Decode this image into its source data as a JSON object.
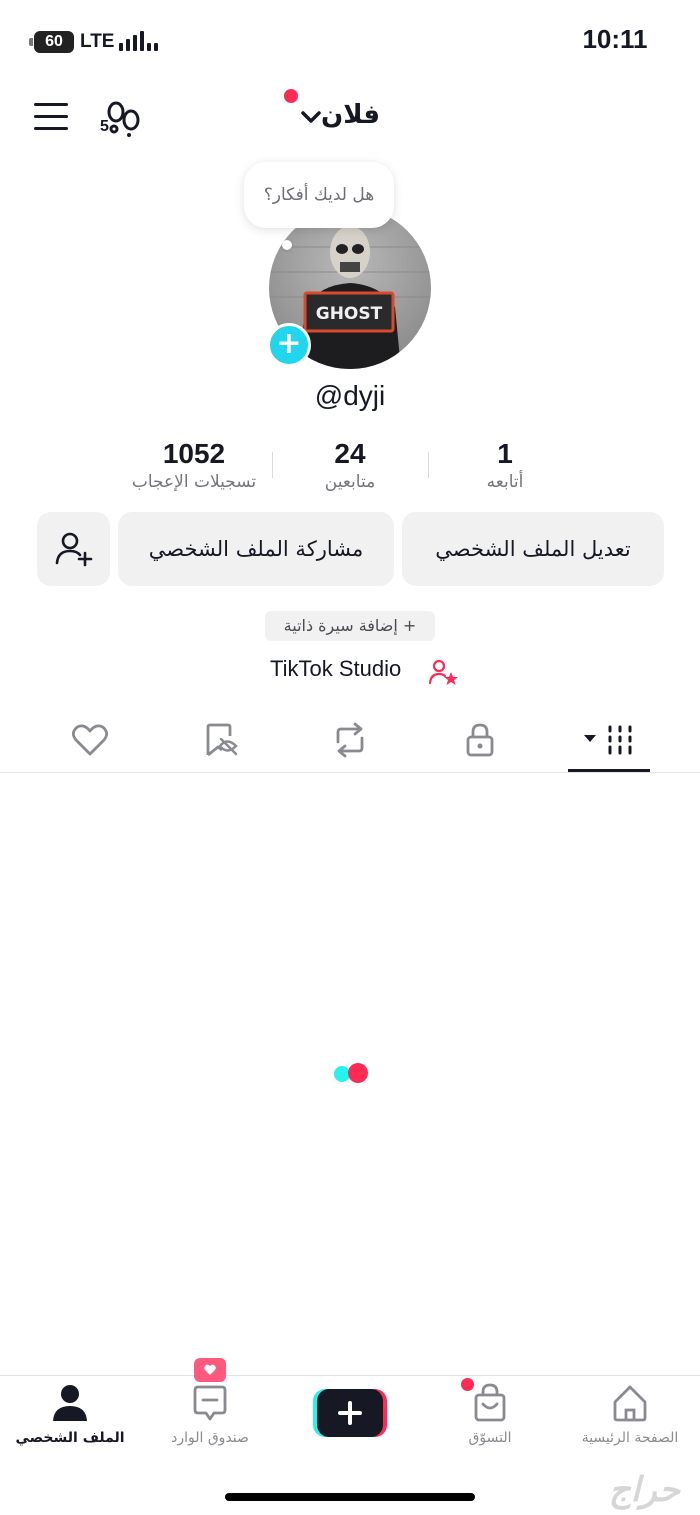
{
  "status_bar": {
    "time": "10:11",
    "battery": "60",
    "network": "LTE"
  },
  "header": {
    "title": "فلان",
    "footprint_count": "5"
  },
  "profile": {
    "thought_bubble": "هل لديك أفكار؟",
    "handle": "@dyji",
    "avatar_text": "GHOST"
  },
  "stats": [
    {
      "value": "1052",
      "label": "تسجيلات الإعجاب"
    },
    {
      "value": "24",
      "label": "متابعين"
    },
    {
      "value": "1",
      "label": "أتابعه"
    }
  ],
  "buttons": {
    "edit_profile": "تعديل الملف الشخصي",
    "share_profile": "مشاركة الملف الشخصي"
  },
  "bio_button": "+ إضافة سيرة ذاتية",
  "studio_link": "TikTok Studio",
  "tabs": [
    "videos",
    "private",
    "reposts",
    "favorites",
    "liked"
  ],
  "bottom_nav": {
    "home": "الصفحة الرئيسية",
    "shop": "التسوّق",
    "inbox": "صندوق الوارد",
    "profile": "الملف الشخصي"
  },
  "watermark": "حراج",
  "colors": {
    "accent_red": "#fe2c55",
    "accent_cyan": "#25f4ee",
    "avatar_add": "#20d5ec",
    "text": "#161823",
    "button_bg": "#f1f1f2"
  }
}
